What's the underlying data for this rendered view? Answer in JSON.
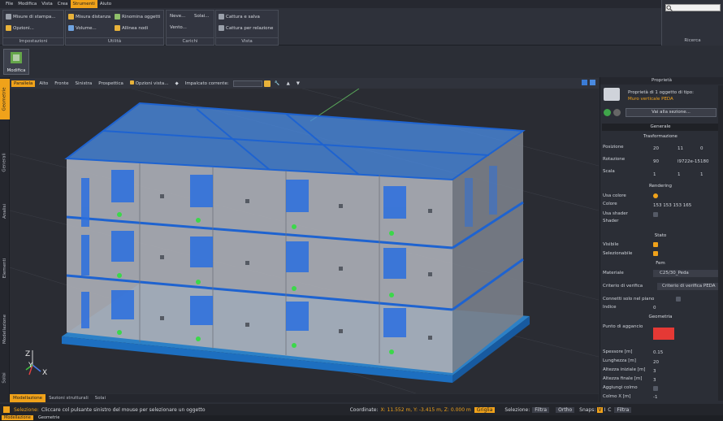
{
  "menu": [
    "File",
    "Modifica",
    "Vista",
    "Crea",
    "Strumenti",
    "Aiuto"
  ],
  "menu_active": "Strumenti",
  "ribbon": {
    "groups": [
      {
        "title": "Impostazioni",
        "buttons": [
          "Misure di stampa...",
          "Opzioni..."
        ]
      },
      {
        "title": "Utilità",
        "buttons": [
          "Misura distanza",
          "Volume...",
          "Rinomina oggetti",
          "Allinea nodi"
        ]
      },
      {
        "title": "Carichi",
        "buttons": [
          "Neve...",
          "Solai...",
          "Vento..."
        ]
      },
      {
        "title": "Vista",
        "buttons": [
          "Cattura e salva",
          "Cattura per relazione"
        ]
      }
    ],
    "search_title": "Ricerca"
  },
  "module_button": "Modifica",
  "left_tabs": [
    "Geometrie",
    "Generali",
    "Analisi",
    "Elementi",
    "Modellazione",
    "Solai"
  ],
  "left_tab_active": "Geometrie",
  "view_toolbar": {
    "views": [
      "Parallela",
      "Alto",
      "Fronte",
      "Sinistra",
      "Prospettica"
    ],
    "active_view": "Parallela",
    "options": "Opzioni vista...",
    "current_level_label": "Impalcato corrente:"
  },
  "axes": {
    "z": "Z",
    "y": "Y",
    "x": "X"
  },
  "bottom_tabs": [
    "Modellazione",
    "Sezioni strutturali",
    "Solai"
  ],
  "bottom_tab_active": "Modellazione",
  "status": {
    "selection_label": "Selezione:",
    "selection_text": "Cliccare col pulsante sinistro del mouse per selezionare un oggetto",
    "coords_label": "Coordinate:",
    "coords_value": "X: 11.552 m, Y: -3.415 m, Z: 0.000 m",
    "grid": "Griglia",
    "selection2": "Selezione:",
    "filter": "Filtra",
    "ortho": "Ortho",
    "snaps": "Snaps:",
    "snap_keys": [
      "V",
      "I",
      "C"
    ],
    "filter2": "Filtra"
  },
  "bottom_tabs2": [
    "Modellazione",
    "Geometrie"
  ],
  "props": {
    "title": "Proprietà",
    "header": "Proprietà di 1 oggetto di tipo:",
    "object_type": "Muro verticale PEDA",
    "goto": "Vai alla sezione...",
    "sections": {
      "generale": "Generale",
      "trasformazione": "Trasformazione",
      "rendering": "Rendering",
      "stato": "Stato",
      "fem": "Fem",
      "geometria": "Geometria"
    },
    "rows": {
      "posizione": {
        "label": "Posizione",
        "values": [
          "20",
          "11",
          "0"
        ]
      },
      "rotazione": {
        "label": "Rotazione",
        "values": [
          "90",
          "l9722e-15",
          "180"
        ]
      },
      "scala": {
        "label": "Scala",
        "values": [
          "1",
          "1",
          "1"
        ]
      },
      "usa_colore": "Usa colore",
      "colore": {
        "label": "Colore",
        "value": "153 153 153 165"
      },
      "usa_shader": "Usa shader",
      "shader": "Shader",
      "visibile": "Visibile",
      "selezionabile": "Selezionabile",
      "materiale": {
        "label": "Materiale",
        "value": "C25/30_Peda"
      },
      "criterio": {
        "label": "Criterio di verifica",
        "value": "Criterio di verifica PEDA"
      },
      "connetti": "Connetti solo nel piano",
      "indice": {
        "label": "Indice",
        "value": "0"
      },
      "punto": "Punto di aggancio",
      "spessore": {
        "label": "Spessore [m]",
        "value": "0.15"
      },
      "lunghezza": {
        "label": "Lunghezza [m]",
        "value": "20"
      },
      "altezza_iniziale": {
        "label": "Altezza iniziale [m]",
        "value": "3"
      },
      "altezza_finale": {
        "label": "Altezza finale [m]",
        "value": "3"
      },
      "aggiungi_colmo": "Aggiungi colmo",
      "colmo_x": {
        "label": "Colmo X [m]",
        "value": "-1"
      }
    },
    "colors": {
      "swatch": "#999999",
      "anchor": "#e53935",
      "accent": "#f0a21a"
    }
  }
}
